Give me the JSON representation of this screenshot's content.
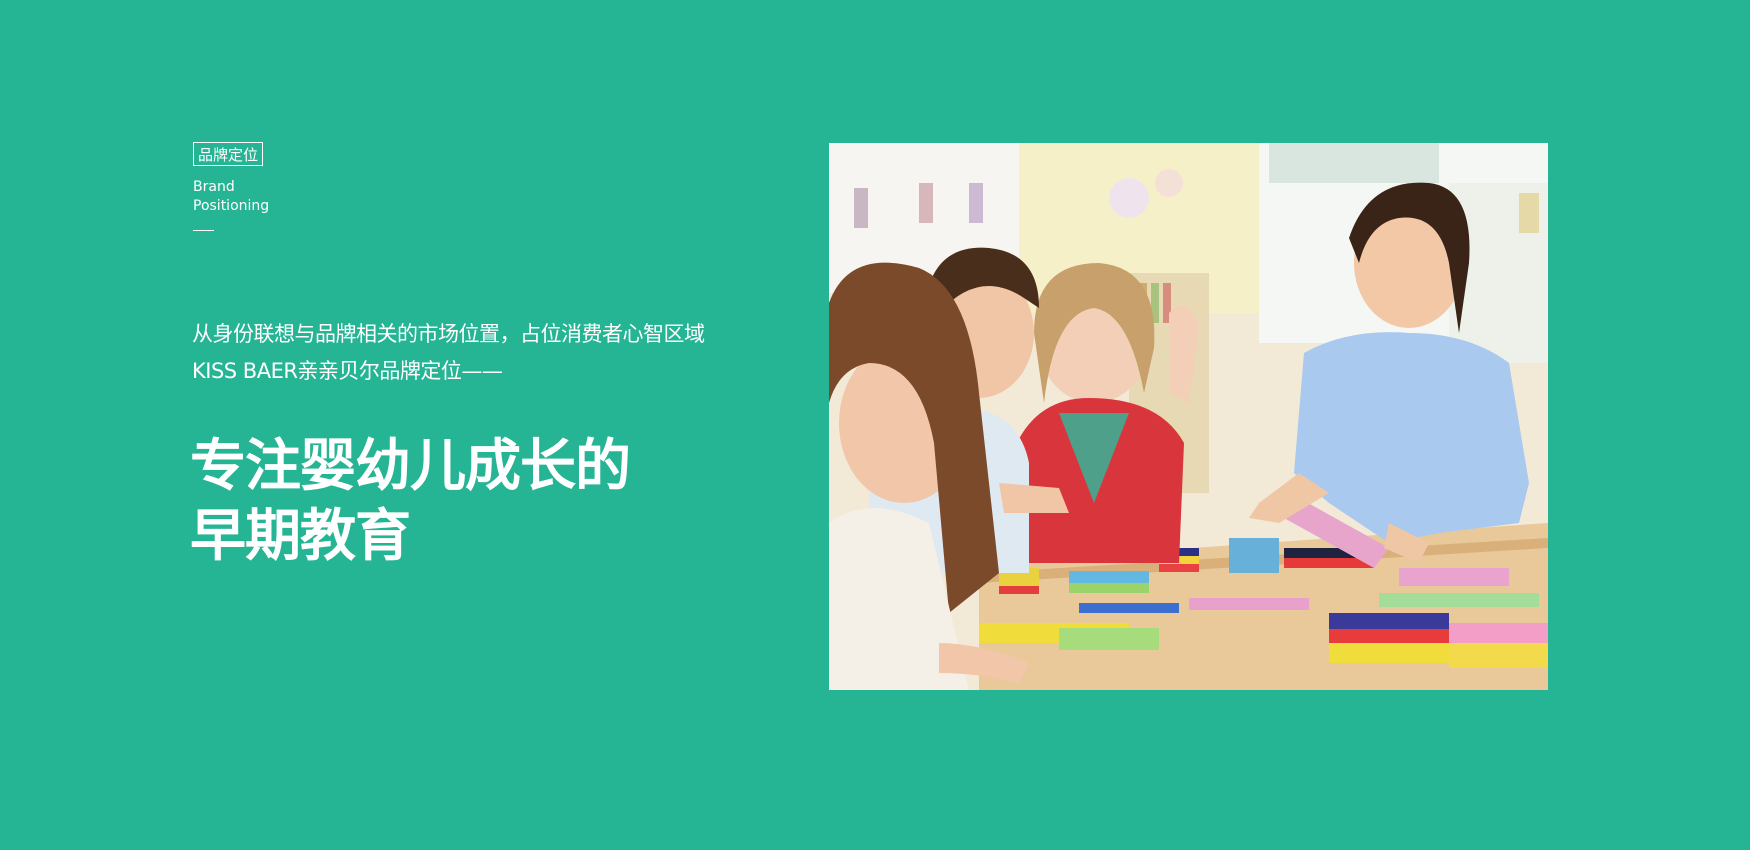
{
  "brand_tag": {
    "cn": "品牌定位",
    "en_line1": "Brand",
    "en_line2": "Positioning"
  },
  "intro": {
    "line1": "从身份联想与品牌相关的市场位置，占位消费者心智区域",
    "line2": "KISS BAER亲亲贝尔品牌定位——"
  },
  "headline": {
    "line1": "专注婴幼儿成长的",
    "line2": "早期教育"
  },
  "photo": {
    "icon": "classroom-photo"
  },
  "colors": {
    "background": "#26b594",
    "text": "#ffffff"
  }
}
